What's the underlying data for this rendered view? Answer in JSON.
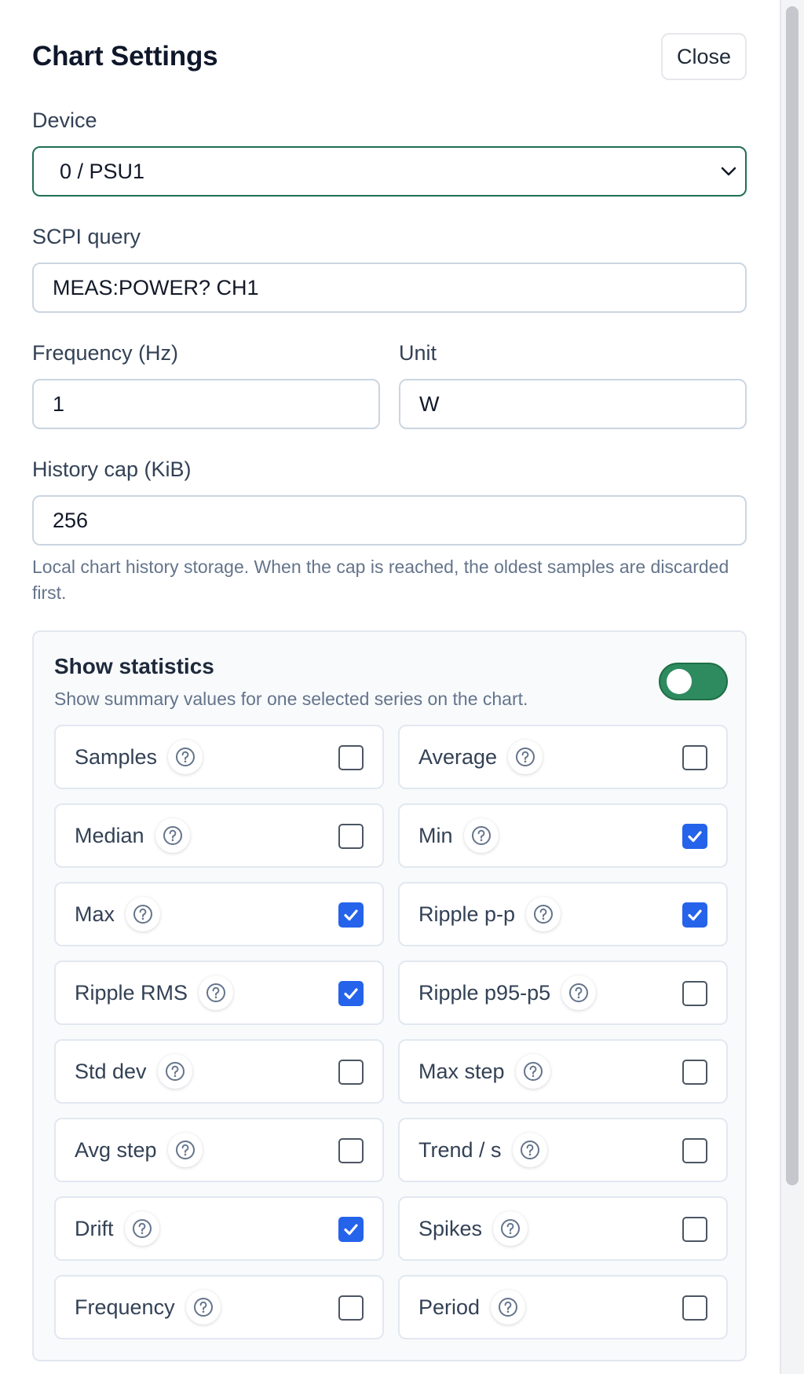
{
  "dialog": {
    "title": "Chart Settings",
    "close_label": "Close"
  },
  "device": {
    "label": "Device",
    "value": "0 / PSU1"
  },
  "scpi": {
    "label": "SCPI query",
    "value": "MEAS:POWER? CH1"
  },
  "frequency": {
    "label": "Frequency (Hz)",
    "value": "1"
  },
  "unit": {
    "label": "Unit",
    "value": "W"
  },
  "history": {
    "label": "History cap (KiB)",
    "value": "256",
    "help": "Local chart history storage. When the cap is reached, the oldest samples are discarded first."
  },
  "statistics": {
    "title": "Show statistics",
    "subtitle": "Show summary values for one selected series on the chart.",
    "enabled": true,
    "toggle_color": "#2e8b5f",
    "check_color": "#2563eb",
    "items": [
      {
        "label": "Samples",
        "checked": false
      },
      {
        "label": "Average",
        "checked": false
      },
      {
        "label": "Median",
        "checked": false
      },
      {
        "label": "Min",
        "checked": true
      },
      {
        "label": "Max",
        "checked": true
      },
      {
        "label": "Ripple p-p",
        "checked": true
      },
      {
        "label": "Ripple RMS",
        "checked": true
      },
      {
        "label": "Ripple p95-p5",
        "checked": false
      },
      {
        "label": "Std dev",
        "checked": false
      },
      {
        "label": "Max step",
        "checked": false
      },
      {
        "label": "Avg step",
        "checked": false
      },
      {
        "label": "Trend / s",
        "checked": false
      },
      {
        "label": "Drift",
        "checked": true
      },
      {
        "label": "Spikes",
        "checked": false
      },
      {
        "label": "Frequency",
        "checked": false
      },
      {
        "label": "Period",
        "checked": false
      }
    ]
  }
}
